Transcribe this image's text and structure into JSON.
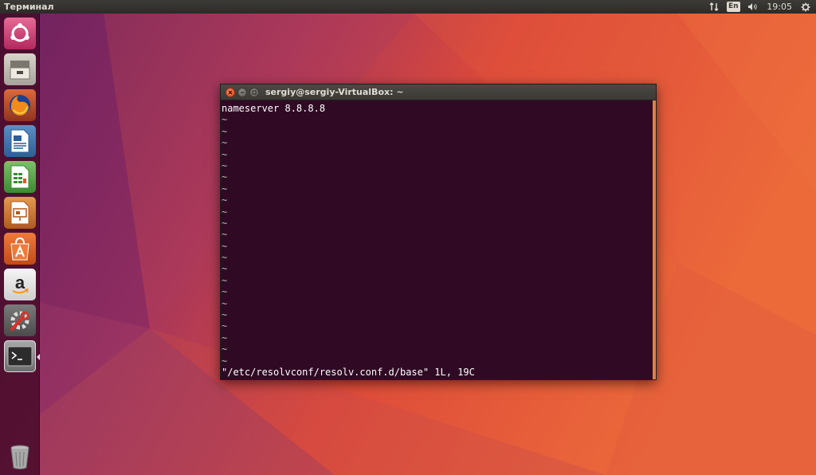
{
  "top_panel": {
    "app_title": "Терминал",
    "keyboard_layout": "En",
    "clock": "19:05",
    "icons": [
      "network-icon",
      "volume-icon",
      "settings-gear-icon"
    ]
  },
  "launcher": {
    "items": [
      {
        "name": "ubuntu-dash",
        "icon": "ubuntu-logo-icon"
      },
      {
        "name": "files",
        "icon": "file-cabinet-icon"
      },
      {
        "name": "firefox",
        "icon": "firefox-icon"
      },
      {
        "name": "libreoffice-writer",
        "icon": "writer-document-icon"
      },
      {
        "name": "libreoffice-calc",
        "icon": "calc-spreadsheet-icon"
      },
      {
        "name": "libreoffice-impress",
        "icon": "impress-presentation-icon"
      },
      {
        "name": "ubuntu-software",
        "icon": "software-bag-icon"
      },
      {
        "name": "amazon",
        "icon": "amazon-icon"
      },
      {
        "name": "system-settings",
        "icon": "settings-wrench-icon"
      },
      {
        "name": "terminal",
        "icon": "terminal-icon",
        "active": true
      },
      {
        "name": "trash",
        "icon": "trash-icon"
      }
    ]
  },
  "terminal": {
    "title": "sergiy@sergiy-VirtualBox: ~",
    "lines": [
      "nameserver 8.8.8.8",
      "~",
      "~",
      "~",
      "~",
      "~",
      "~",
      "~",
      "~",
      "~",
      "~",
      "~",
      "~",
      "~",
      "~",
      "~",
      "~",
      "~",
      "~",
      "~",
      "~",
      "~",
      "~"
    ],
    "status_line": "\"/etc/resolvconf/resolv.conf.d/base\" 1L, 19C"
  },
  "colors": {
    "terminal_bg": "#300a24",
    "accent_orange": "#e95420",
    "panel_bg": "#3c3b37"
  }
}
